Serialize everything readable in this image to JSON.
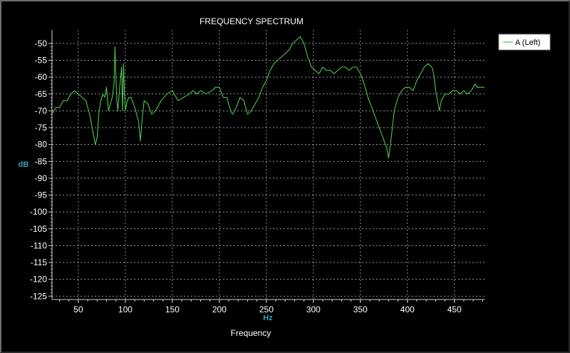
{
  "chart_data": {
    "type": "line",
    "title": "FREQUENCY  SPECTRUM",
    "xlabel": "Frequency",
    "x_unit": "Hz",
    "y_unit": "dB",
    "xlim": [
      22,
      482
    ],
    "ylim": [
      -126,
      -46
    ],
    "x_ticks": [
      50,
      100,
      150,
      200,
      250,
      300,
      350,
      400,
      450
    ],
    "y_ticks": [
      -50,
      -55,
      -60,
      -65,
      -70,
      -75,
      -80,
      -85,
      -90,
      -95,
      -100,
      -105,
      -110,
      -115,
      -120,
      -125
    ],
    "grid": true,
    "legend_position": "top-right",
    "colors": {
      "background": "#000000",
      "series": "#4ec24e",
      "grid": "#c8c8c8",
      "unit": "#2f9fbf"
    },
    "series": [
      {
        "name": "A (Left)",
        "x": [
          22,
          26,
          30,
          34,
          38,
          42,
          46,
          50,
          54,
          58,
          62,
          66,
          68,
          70,
          72,
          74,
          76,
          78,
          80,
          82,
          84,
          86,
          88,
          89,
          90,
          91,
          92,
          94,
          96,
          97,
          98,
          99,
          100,
          102,
          104,
          106,
          110,
          114,
          116,
          118,
          120,
          124,
          128,
          132,
          138,
          144,
          150,
          156,
          162,
          168,
          172,
          176,
          180,
          186,
          192,
          196,
          200,
          204,
          208,
          212,
          214,
          218,
          222,
          226,
          230,
          234,
          238,
          242,
          246,
          250,
          254,
          258,
          262,
          266,
          270,
          274,
          278,
          282,
          286,
          288,
          290,
          294,
          298,
          302,
          306,
          310,
          314,
          318,
          322,
          326,
          330,
          334,
          338,
          342,
          346,
          350,
          354,
          358,
          362,
          366,
          370,
          374,
          378,
          380,
          382,
          384,
          386,
          390,
          394,
          398,
          402,
          406,
          410,
          414,
          418,
          422,
          426,
          428,
          430,
          432,
          434,
          436,
          440,
          444,
          448,
          452,
          456,
          460,
          464,
          468,
          470,
          472,
          474,
          476,
          478,
          482
        ],
        "y": [
          -71,
          -69,
          -69,
          -67,
          -67,
          -65,
          -64,
          -65,
          -66,
          -67,
          -71,
          -77,
          -80,
          -78,
          -70,
          -67,
          -65,
          -66,
          -63,
          -70,
          -68,
          -66,
          -62,
          -51,
          -60,
          -67,
          -70,
          -63,
          -57,
          -70,
          -56,
          -64,
          -70,
          -67,
          -66,
          -66,
          -69,
          -73,
          -79,
          -72,
          -67,
          -68,
          -71,
          -70,
          -67,
          -65,
          -64,
          -67,
          -66,
          -65,
          -64,
          -65,
          -64,
          -65,
          -64,
          -63,
          -63,
          -66,
          -66,
          -70,
          -71,
          -69,
          -66,
          -67,
          -71,
          -70,
          -68,
          -66,
          -63,
          -61,
          -58,
          -56,
          -55,
          -54,
          -53,
          -52,
          -50,
          -49,
          -48,
          -49,
          -50,
          -54,
          -57,
          -58,
          -59,
          -57,
          -58,
          -58,
          -59,
          -58,
          -57,
          -57,
          -58,
          -57,
          -57,
          -59,
          -62,
          -66,
          -69,
          -72,
          -75,
          -78,
          -81,
          -84,
          -80,
          -75,
          -70,
          -66,
          -64,
          -63,
          -63,
          -64,
          -61,
          -59,
          -57,
          -56,
          -57,
          -59,
          -64,
          -67,
          -70,
          -67,
          -65,
          -65,
          -64,
          -64,
          -65,
          -64,
          -65,
          -64,
          -63,
          -62,
          -63,
          -63,
          -63,
          -63
        ]
      }
    ]
  }
}
